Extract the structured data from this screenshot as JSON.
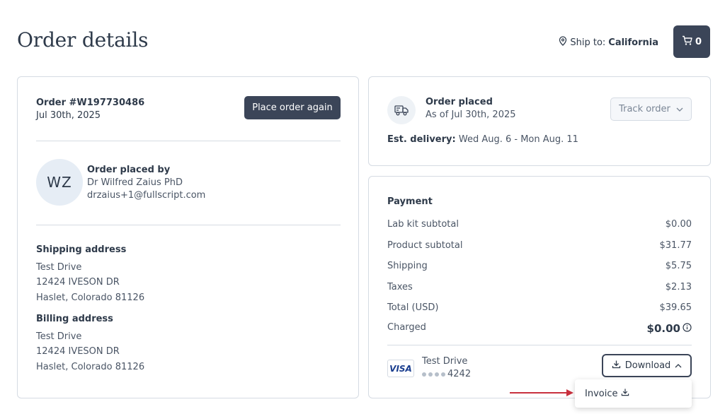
{
  "header": {
    "title": "Order details",
    "ship_to_label": "Ship to:",
    "ship_to_value": "California",
    "cart_count": "0"
  },
  "order": {
    "number": "Order #W197730486",
    "date": "Jul 30th, 2025",
    "place_again_label": "Place order again"
  },
  "placed_by": {
    "initials": "WZ",
    "title": "Order placed by",
    "name": "Dr Wilfred Zaius PhD",
    "email": "drzaius+1@fullscript.com"
  },
  "shipping_address": {
    "title": "Shipping address",
    "line1": "Test Drive",
    "line2": "12424 IVESON DR",
    "line3": "Haslet, Colorado 81126"
  },
  "billing_address": {
    "title": "Billing address",
    "line1": "Test Drive",
    "line2": "12424 IVESON DR",
    "line3": "Haslet, Colorado 81126"
  },
  "status": {
    "title": "Order placed",
    "subtitle": "As of Jul 30th, 2025",
    "track_label": "Track order",
    "est_label": "Est. delivery:",
    "est_value": "Wed Aug. 6 - Mon Aug. 11"
  },
  "payment": {
    "title": "Payment",
    "rows": [
      {
        "label": "Lab kit subtotal",
        "amount": "$0.00"
      },
      {
        "label": "Product subtotal",
        "amount": "$31.77"
      },
      {
        "label": "Shipping",
        "amount": "$5.75"
      },
      {
        "label": "Taxes",
        "amount": "$2.13"
      },
      {
        "label": "Total (USD)",
        "amount": "$39.65"
      },
      {
        "label": "Charged",
        "amount": "$0.00"
      }
    ],
    "card_brand": "VISA",
    "card_holder": "Test Drive",
    "card_last4": "4242",
    "download_label": "Download",
    "dropdown_item": "Invoice"
  },
  "colors": {
    "primary_dark": "#3b4558",
    "border": "#d5dbe3",
    "annotation_arrow": "#c8303e"
  },
  "icons": [
    "location-pin-icon",
    "cart-icon",
    "truck-icon",
    "chevron-down-icon",
    "info-icon",
    "download-icon",
    "chevron-up-icon"
  ]
}
